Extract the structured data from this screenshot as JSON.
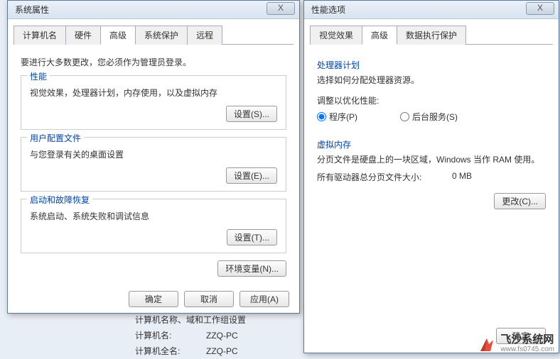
{
  "win1": {
    "title": "系统属性",
    "close": "X",
    "tabs": {
      "t0": "计算机名",
      "t1": "硬件",
      "t2": "高级",
      "t3": "系统保护",
      "t4": "远程"
    },
    "intro": "要进行大多数更改，您必须作为管理员登录。",
    "grp1": {
      "title": "性能",
      "desc": "视觉效果，处理器计划，内存使用，以及虚拟内存",
      "btn": "设置(S)..."
    },
    "grp2": {
      "title": "用户配置文件",
      "desc": "与您登录有关的桌面设置",
      "btn": "设置(E)..."
    },
    "grp3": {
      "title": "启动和故障恢复",
      "desc": "系统启动、系统失败和调试信息",
      "btn": "设置(T)..."
    },
    "envBtn": "环境变量(N)...",
    "ok": "确定",
    "cancel": "取消",
    "apply": "应用(A)"
  },
  "win2": {
    "title": "性能选项",
    "close": "X",
    "tabs": {
      "t0": "视觉效果",
      "t1": "高级",
      "t2": "数据执行保护"
    },
    "cpu": {
      "title": "处理器计划",
      "desc": "选择如何分配处理器资源。",
      "adjust": "调整以优化性能:",
      "opt1": "程序(P)",
      "opt2": "后台服务(S)"
    },
    "vm": {
      "title": "虚拟内存",
      "desc": "分页文件是硬盘上的一块区域，Windows 当作 RAM 使用。",
      "sizeLabel": "所有驱动器总分页文件大小:",
      "sizeValue": "0 MB",
      "btn": "更改(C)..."
    },
    "ok": "确定"
  },
  "bg": {
    "heading": "计算机名称、域和工作组设置",
    "l1": "计算机名:",
    "v1": "ZZQ-PC",
    "l2": "计算机全名:",
    "v2": "ZZQ-PC"
  },
  "wm": {
    "main": "飞沙系统网",
    "sub": "www.fs0745.com"
  }
}
